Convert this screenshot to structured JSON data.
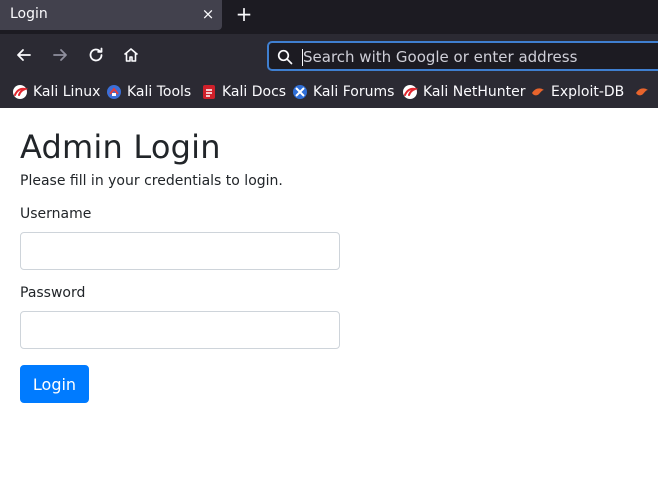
{
  "browser": {
    "tab": {
      "title": "Login",
      "close_glyph": "×"
    },
    "new_tab_glyph": "+",
    "urlbar": {
      "placeholder": "Search with Google or enter address"
    },
    "bookmarks": [
      {
        "label": "Kali Linux",
        "icon": "kali-dragon-icon"
      },
      {
        "label": "Kali Tools",
        "icon": "kali-tools-icon"
      },
      {
        "label": "Kali Docs",
        "icon": "kali-docs-icon"
      },
      {
        "label": "Kali Forums",
        "icon": "kali-forums-icon"
      },
      {
        "label": "Kali NetHunter",
        "icon": "kali-dragon-icon"
      },
      {
        "label": "Exploit-DB",
        "icon": "exploit-db-icon"
      }
    ]
  },
  "page": {
    "title": "Admin Login",
    "description": "Please fill in your credentials to login.",
    "username_label": "Username",
    "username_value": "",
    "password_label": "Password",
    "password_value": "",
    "login_button": "Login"
  },
  "colors": {
    "accent": "#007bff",
    "urlbar_focus": "#3f7fd0",
    "toolbar": "#2b2a33",
    "tabstrip": "#1c1b22"
  }
}
